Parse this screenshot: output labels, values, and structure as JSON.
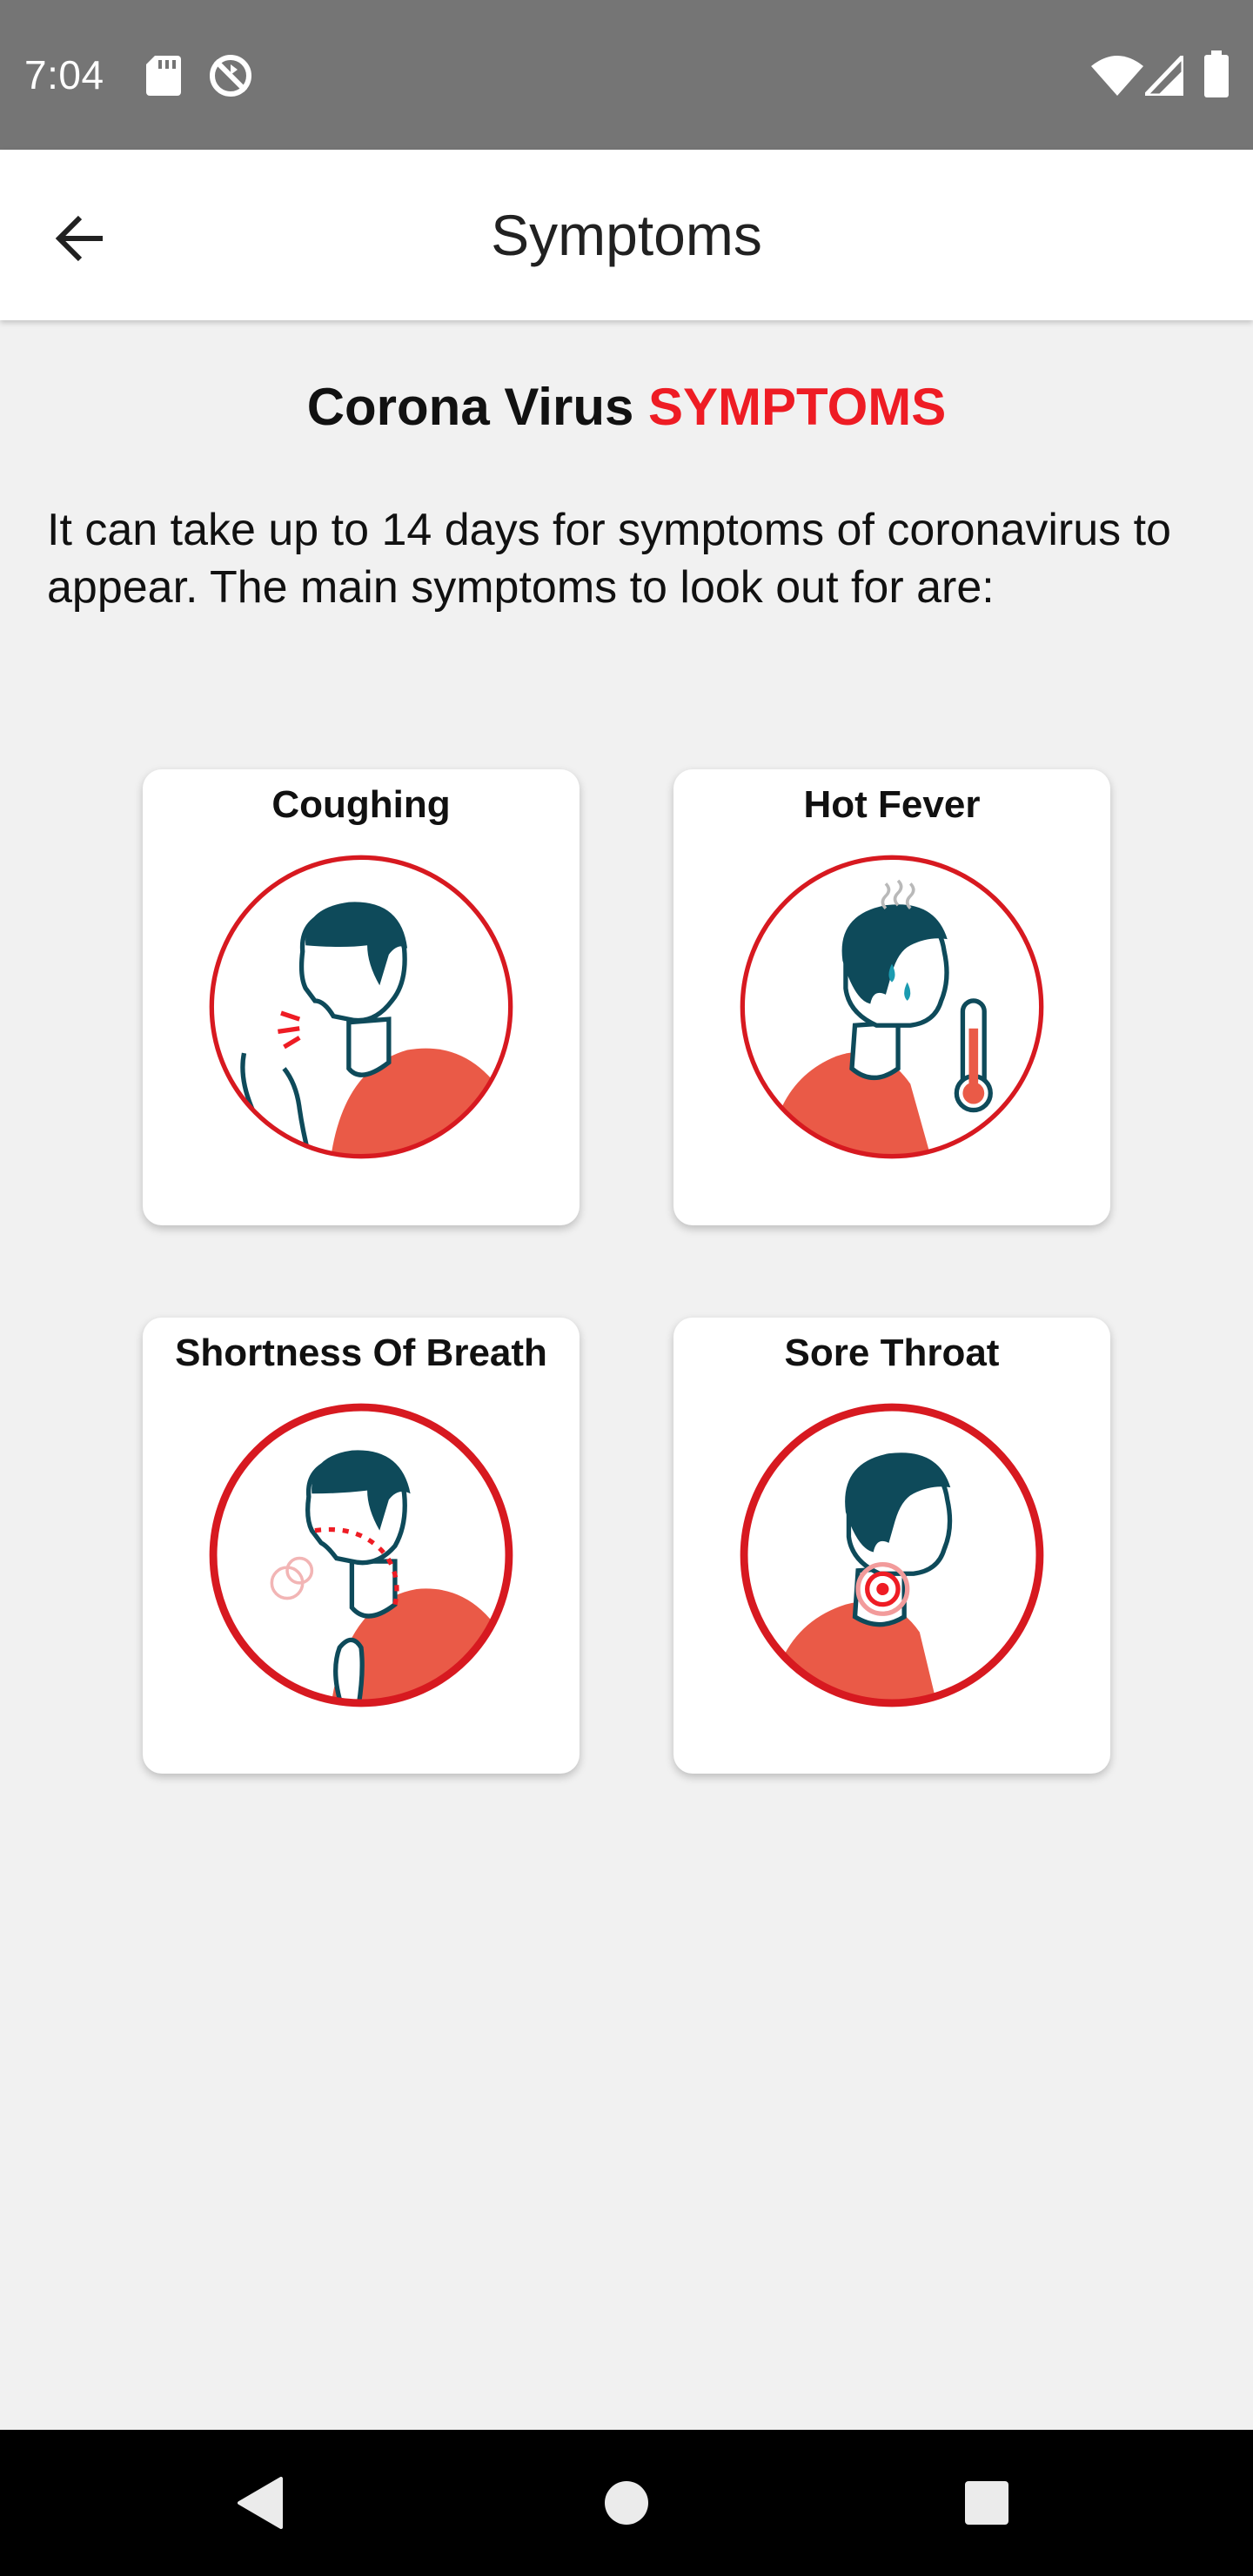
{
  "status_bar": {
    "time": "7:04",
    "icons": [
      "sd-card-icon",
      "no-sync-icon",
      "wifi-icon",
      "signal-icon",
      "battery-icon"
    ]
  },
  "app_bar": {
    "title": "Symptoms",
    "back_icon": "arrow-back-icon"
  },
  "content": {
    "heading_prefix": "Corona Virus",
    "heading_accent": "SYMPTOMS",
    "intro": "It can take up to 14 days for symptoms of coronavirus to appear. The main symptoms to look out for are:",
    "cards": [
      {
        "title": "Coughing",
        "icon": "coughing-icon"
      },
      {
        "title": "Hot Fever",
        "icon": "fever-icon"
      },
      {
        "title": "Shortness Of Breath",
        "icon": "shortness-of-breath-icon"
      },
      {
        "title": "Sore Throat",
        "icon": "sore-throat-icon"
      }
    ]
  },
  "nav_bar": {
    "buttons": [
      "back-triangle-icon",
      "home-circle-icon",
      "recents-square-icon"
    ]
  },
  "colors": {
    "accent": "#ee1c24",
    "status_bar": "#757575",
    "background": "#f1f1f1",
    "illustration_red": "#ea5a47",
    "illustration_dark": "#0e4a5a",
    "circle_red": "#d71920"
  }
}
